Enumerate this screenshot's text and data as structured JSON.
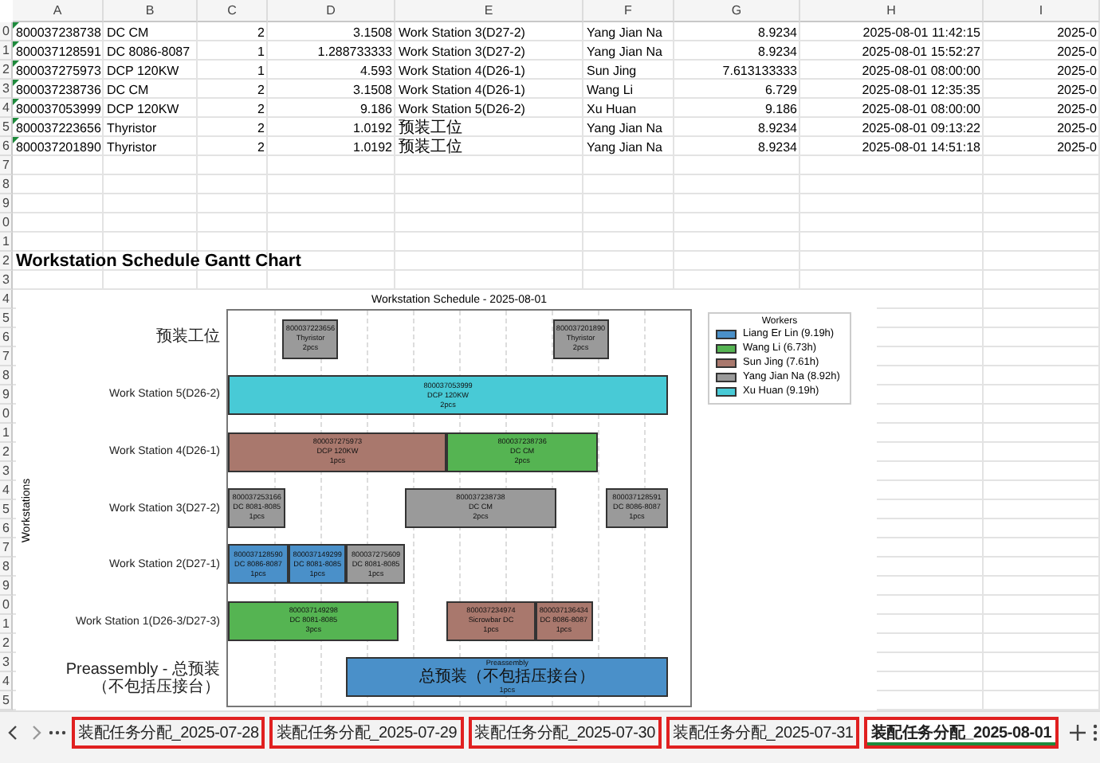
{
  "columns": [
    "A",
    "B",
    "C",
    "D",
    "E",
    "F",
    "G",
    "H",
    "I"
  ],
  "rows": [
    {
      "number": "0",
      "flag": true,
      "cells": [
        "800037238738",
        "DC CM",
        "2",
        "3.1508",
        "Work Station 3(D27-2)",
        "Yang Jian Na",
        "8.9234",
        "2025-08-01 11:42:15",
        "2025-0"
      ]
    },
    {
      "number": "1",
      "flag": true,
      "cells": [
        "800037128591",
        "DC 8086-8087",
        "1",
        "1.288733333",
        "Work Station 3(D27-2)",
        "Yang Jian Na",
        "8.9234",
        "2025-08-01 15:52:27",
        "2025-0"
      ]
    },
    {
      "number": "2",
      "flag": true,
      "cells": [
        "800037275973",
        "DCP 120KW",
        "1",
        "4.593",
        "Work Station 4(D26-1)",
        "Sun Jing",
        "7.613133333",
        "2025-08-01 08:00:00",
        "2025-0"
      ]
    },
    {
      "number": "3",
      "flag": true,
      "cells": [
        "800037238736",
        "DC CM",
        "2",
        "3.1508",
        "Work Station 4(D26-1)",
        "Wang Li",
        "6.729",
        "2025-08-01 12:35:35",
        "2025-0"
      ]
    },
    {
      "number": "4",
      "flag": true,
      "cells": [
        "800037053999",
        "DCP 120KW",
        "2",
        "9.186",
        "Work Station 5(D26-2)",
        "Xu Huan",
        "9.186",
        "2025-08-01 08:00:00",
        "2025-0"
      ]
    },
    {
      "number": "5",
      "flag": true,
      "cells": [
        "800037223656",
        "Thyristor",
        "2",
        "1.0192",
        "预装工位",
        "Yang Jian Na",
        "8.9234",
        "2025-08-01 09:13:22",
        "2025-0"
      ]
    },
    {
      "number": "6",
      "flag": true,
      "cells": [
        "800037201890",
        "Thyristor",
        "2",
        "1.0192",
        "预装工位",
        "Yang Jian Na",
        "8.9234",
        "2025-08-01 14:51:18",
        "2025-0"
      ]
    },
    {
      "number": "7"
    },
    {
      "number": "8"
    },
    {
      "number": "9"
    },
    {
      "number": "0"
    },
    {
      "number": "1"
    },
    {
      "number": "2",
      "title": "Workstation Schedule Gantt Chart"
    },
    {
      "number": "3"
    },
    {
      "number": "4"
    },
    {
      "number": "5"
    },
    {
      "number": "6"
    },
    {
      "number": "7"
    },
    {
      "number": "8"
    },
    {
      "number": "9"
    },
    {
      "number": "0"
    },
    {
      "number": "1"
    },
    {
      "number": "2"
    },
    {
      "number": "3"
    },
    {
      "number": "4"
    },
    {
      "number": "5"
    },
    {
      "number": "6"
    },
    {
      "number": "7"
    },
    {
      "number": "8"
    },
    {
      "number": "9"
    },
    {
      "number": "0"
    },
    {
      "number": "1"
    },
    {
      "number": "2"
    },
    {
      "number": "3"
    },
    {
      "number": "4"
    },
    {
      "number": "5"
    }
  ],
  "gantt": {
    "title": "Workstation Schedule - 2025-08-01",
    "ylabel": "Workstations",
    "lanes": [
      {
        "label": "预装工位",
        "bars": [
          {
            "order": "800037223656",
            "product": "Thyristor",
            "qty": "2pcs",
            "color": "#9a9a9a"
          },
          {
            "order": "800037201890",
            "product": "Thyristor",
            "qty": "2pcs",
            "color": "#9a9a9a"
          }
        ]
      },
      {
        "label": "Work Station 5(D26-2)",
        "bars": [
          {
            "order": "800037053999",
            "product": "DCP 120KW",
            "qty": "2pcs",
            "color": "#48cad6"
          }
        ]
      },
      {
        "label": "Work Station 4(D26-1)",
        "bars": [
          {
            "order": "800037275973",
            "product": "DCP 120KW",
            "qty": "1pcs",
            "color": "#a9786d"
          },
          {
            "order": "800037238736",
            "product": "DC CM",
            "qty": "2pcs",
            "color": "#55b452"
          }
        ]
      },
      {
        "label": "Work Station 3(D27-2)",
        "bars": [
          {
            "order": "800037253166",
            "product": "DC 8081-8085",
            "qty": "1pcs",
            "color": "#9a9a9a"
          },
          {
            "order": "800037238738",
            "product": "DC CM",
            "qty": "2pcs",
            "color": "#9a9a9a"
          },
          {
            "order": "800037128591",
            "product": "DC 8086-8087",
            "qty": "1pcs",
            "color": "#9a9a9a"
          }
        ]
      },
      {
        "label": "Work Station 2(D27-1)",
        "bars": [
          {
            "order": "800037128590",
            "product": "DC 8086-8087",
            "qty": "1pcs",
            "color": "#4a90c9"
          },
          {
            "order": "800037149299",
            "product": "DC 8081-8085",
            "qty": "1pcs",
            "color": "#4a90c9"
          },
          {
            "order": "800037275609",
            "product": "DC 8081-8085",
            "qty": "1pcs",
            "color": "#9a9a9a"
          }
        ]
      },
      {
        "label": "Work Station 1(D26-3/D27-3)",
        "bars": [
          {
            "order": "800037149298",
            "product": "DC 8081-8085",
            "qty": "3pcs",
            "color": "#55b452"
          },
          {
            "order": "800037234974",
            "product": "Sicrowbar DC",
            "qty": "1pcs",
            "color": "#a9786d"
          },
          {
            "order": "800037136434",
            "product": "DC 8086-8087",
            "qty": "1pcs",
            "color": "#a9786d"
          }
        ]
      },
      {
        "label": "Preassembly - 总预装（不包括压接台）",
        "bars": [
          {
            "order": "Preassembly",
            "product": "总预装（不包括压接台）",
            "qty": "1pcs",
            "color": "#4a90c9"
          }
        ]
      }
    ],
    "legend": {
      "title": "Workers",
      "items": [
        {
          "label": "Liang Er Lin (9.19h)",
          "color": "#4a90c9"
        },
        {
          "label": "Wang Li (6.73h)",
          "color": "#55b452"
        },
        {
          "label": "Sun Jing (7.61h)",
          "color": "#a9786d"
        },
        {
          "label": "Yang Jian Na (8.92h)",
          "color": "#9a9a9a"
        },
        {
          "label": "Xu Huan (9.19h)",
          "color": "#48cad6"
        }
      ]
    }
  },
  "sheet_tabs": [
    {
      "label": "装配任务分配_2025-07-28",
      "selected": false,
      "outlined": true
    },
    {
      "label": "装配任务分配_2025-07-29",
      "selected": false,
      "outlined": true
    },
    {
      "label": "装配任务分配_2025-07-30",
      "selected": false,
      "outlined": true
    },
    {
      "label": "装配任务分配_2025-07-31",
      "selected": false,
      "outlined": true
    },
    {
      "label": "装配任务分配_2025-08-01",
      "selected": true,
      "outlined": true
    }
  ]
}
